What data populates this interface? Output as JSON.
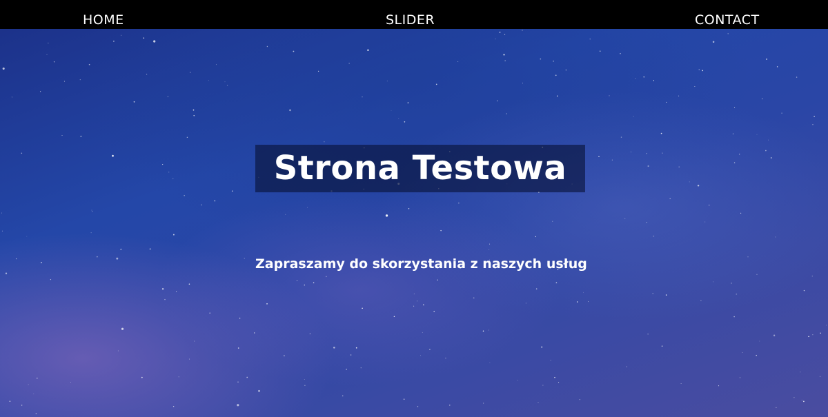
{
  "nav": {
    "home_label": "HOME",
    "slider_label": "SLIDER",
    "contact_label": "CONTACT"
  },
  "hero": {
    "title": "Strona Testowa",
    "subtitle": "Zapraszamy do skorzystania z naszych usług"
  },
  "colors": {
    "navbar_bg": "#000000",
    "sky_blue": "#2447a8",
    "text": "#ffffff"
  }
}
